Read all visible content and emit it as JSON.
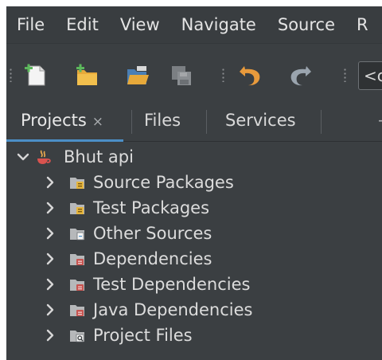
{
  "menubar": {
    "items": [
      "File",
      "Edit",
      "View",
      "Navigate",
      "Source",
      "R"
    ]
  },
  "toolbar": {
    "buttons": [
      {
        "name": "new-file",
        "icon": "new-file-icon"
      },
      {
        "name": "new-project",
        "icon": "new-project-icon"
      },
      {
        "name": "open-project",
        "icon": "open-project-icon"
      },
      {
        "name": "save-all",
        "icon": "save-all-icon"
      },
      {
        "name": "undo",
        "icon": "undo-icon"
      },
      {
        "name": "redo",
        "icon": "redo-icon"
      }
    ],
    "config_combo": {
      "value": "<c"
    }
  },
  "tabs": [
    {
      "label": "Projects",
      "close": "×",
      "active": true
    },
    {
      "label": "Files"
    },
    {
      "label": "Services"
    }
  ],
  "tab_more": "−",
  "tree": {
    "root": {
      "label": "Bhut api",
      "icon": "java-project-icon",
      "expanded": true
    },
    "children": [
      {
        "label": "Source Packages",
        "icon": "source-packages-icon"
      },
      {
        "label": "Test Packages",
        "icon": "test-packages-icon"
      },
      {
        "label": "Other Sources",
        "icon": "other-sources-icon"
      },
      {
        "label": "Dependencies",
        "icon": "dependencies-icon"
      },
      {
        "label": "Test Dependencies",
        "icon": "test-dependencies-icon"
      },
      {
        "label": "Java Dependencies",
        "icon": "java-dependencies-icon"
      },
      {
        "label": "Project Files",
        "icon": "project-files-icon"
      }
    ]
  },
  "colors": {
    "background": "#3b3f42",
    "accent": "#4c8fc7",
    "text": "#dcdcdc",
    "folder": "#b6b8ba",
    "package": "#e5b53f",
    "dependency": "#c75450"
  }
}
